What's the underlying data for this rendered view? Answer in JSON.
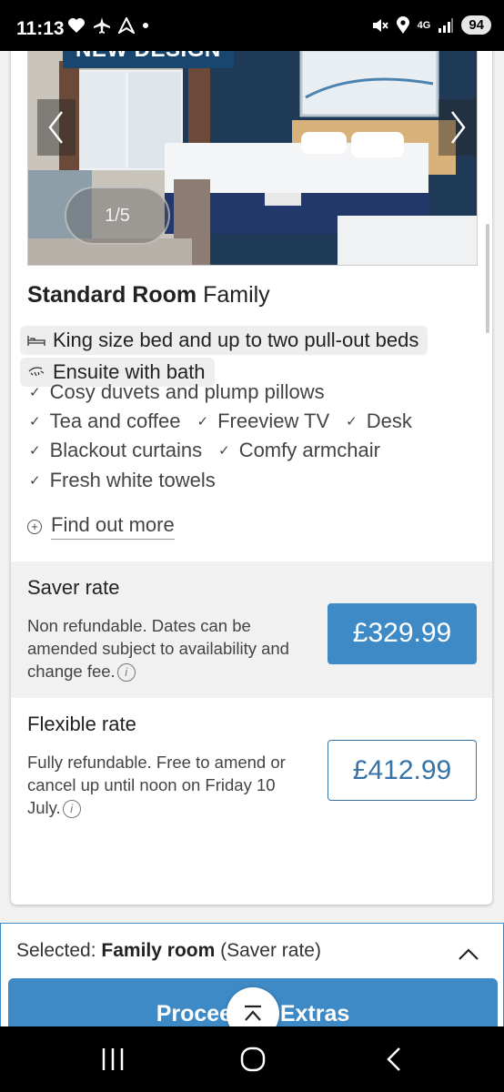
{
  "status_bar": {
    "time": "11:13",
    "left_icons": [
      "heart-icon",
      "airplane-icon",
      "navigation-icon",
      "dot-icon"
    ],
    "right_icons": [
      "mute-icon",
      "location-icon",
      "4g-signal-icon"
    ],
    "network": "4G",
    "battery": "94"
  },
  "gallery": {
    "badge": "NEW DESIGN",
    "counter": "1/5"
  },
  "room": {
    "title_bold": "Standard Room",
    "title_rest": " Family",
    "features": [
      {
        "icon": "bed-icon",
        "label": "King size bed and up to two pull-out beds"
      },
      {
        "icon": "shower-icon",
        "label": "Ensuite with bath"
      }
    ],
    "amenities_rows": [
      [
        "Cosy duvets and plump pillows"
      ],
      [
        "Tea and coffee",
        "Freeview TV",
        "Desk"
      ],
      [
        "Blackout curtains",
        "Comfy armchair"
      ],
      [
        "Fresh white towels"
      ]
    ],
    "find_more": "Find out more"
  },
  "rates": [
    {
      "title": "Saver rate",
      "description": "Non refundable. Dates can be amended subject to availability and change fee.",
      "price": "£329.99",
      "selected": true
    },
    {
      "title": "Flexible rate",
      "description": "Fully refundable. Free to amend or cancel up until noon on Friday 10 July.",
      "price": "£412.99",
      "selected": false
    }
  ],
  "selection": {
    "prefix": "Selected: ",
    "room": "Family room",
    "rate": " (Saver rate)"
  },
  "proceed_label": "Proceed to Extras",
  "colors": {
    "accent": "#3d8ac6",
    "accent_dark": "#3573a8",
    "badge_navy": "#19466f"
  }
}
